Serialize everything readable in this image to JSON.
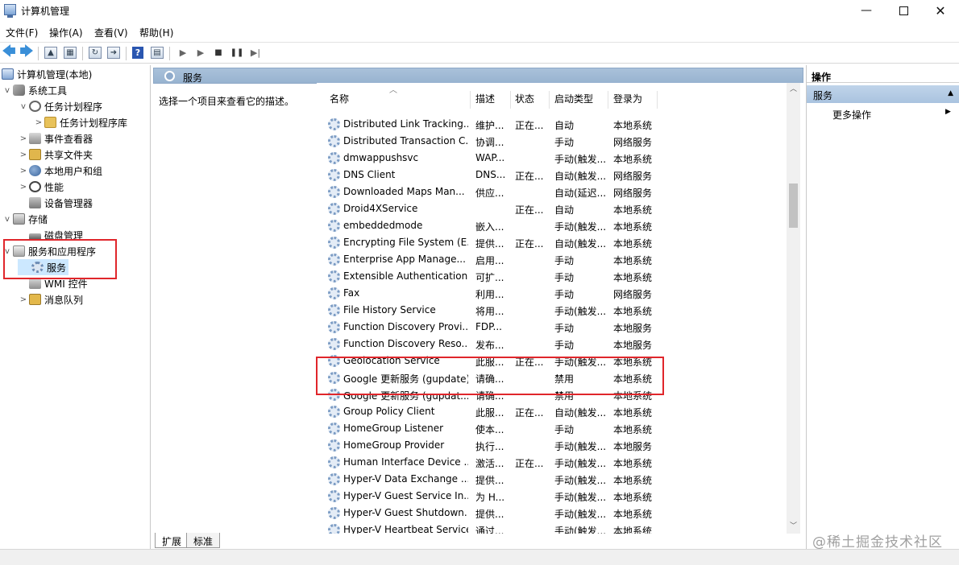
{
  "window": {
    "title": "计算机管理",
    "minimize": "—",
    "close": "✕"
  },
  "menu": [
    "文件(F)",
    "操作(A)",
    "查看(V)",
    "帮助(H)"
  ],
  "toolbar": {
    "back": "🡄",
    "forward": "🡆",
    "help": "?"
  },
  "tree": [
    {
      "label": "计算机管理(本地)",
      "icon": "computer-icon",
      "level": 0,
      "chev": ""
    },
    {
      "label": "系统工具",
      "icon": "tools-icon",
      "level": 1,
      "chev": "v"
    },
    {
      "label": "任务计划程序",
      "icon": "clock-icon",
      "level": 2,
      "chev": "v"
    },
    {
      "label": "任务计划程序库",
      "icon": "folder-icon",
      "level": 3,
      "chev": ">"
    },
    {
      "label": "事件查看器",
      "icon": "event-viewer-icon",
      "level": 2,
      "chev": ">"
    },
    {
      "label": "共享文件夹",
      "icon": "shared-folder-icon",
      "level": 2,
      "chev": ">"
    },
    {
      "label": "本地用户和组",
      "icon": "users-icon",
      "level": 2,
      "chev": ">"
    },
    {
      "label": "性能",
      "icon": "performance-icon",
      "level": 2,
      "chev": ">"
    },
    {
      "label": "设备管理器",
      "icon": "device-manager-icon",
      "level": 2,
      "chev": ""
    },
    {
      "label": "存储",
      "icon": "storage-icon",
      "level": 1,
      "chev": "v"
    },
    {
      "label": "磁盘管理",
      "icon": "disk-icon",
      "level": 2,
      "chev": ""
    },
    {
      "label": "服务和应用程序",
      "icon": "services-apps-icon",
      "level": 1,
      "chev": "v"
    },
    {
      "label": "服务",
      "icon": "gear-icon",
      "level": 2,
      "chev": "",
      "selected": true
    },
    {
      "label": "WMI 控件",
      "icon": "wmi-icon",
      "level": 2,
      "chev": ""
    },
    {
      "label": "消息队列",
      "icon": "message-queue-icon",
      "level": 2,
      "chev": ">"
    }
  ],
  "center": {
    "header": "服务",
    "description": "选择一个项目来查看它的描述。",
    "columns": [
      "名称",
      "描述",
      "状态",
      "启动类型",
      "登录为"
    ],
    "rows": [
      [
        "Distributed Link Tracking...",
        "维护...",
        "正在...",
        "自动",
        "本地系统"
      ],
      [
        "Distributed Transaction C...",
        "协调...",
        "",
        "手动",
        "网络服务"
      ],
      [
        "dmwappushsvc",
        "WAP...",
        "",
        "手动(触发...",
        "本地系统"
      ],
      [
        "DNS Client",
        "DNS...",
        "正在...",
        "自动(触发...",
        "网络服务"
      ],
      [
        "Downloaded Maps Man...",
        "供应...",
        "",
        "自动(延迟...",
        "网络服务"
      ],
      [
        "Droid4XService",
        "",
        "正在...",
        "自动",
        "本地系统"
      ],
      [
        "embeddedmode",
        "嵌入...",
        "",
        "手动(触发...",
        "本地系统"
      ],
      [
        "Encrypting File System (E...",
        "提供...",
        "正在...",
        "自动(触发...",
        "本地系统"
      ],
      [
        "Enterprise App Manage...",
        "启用...",
        "",
        "手动",
        "本地系统"
      ],
      [
        "Extensible Authentication...",
        "可扩...",
        "",
        "手动",
        "本地系统"
      ],
      [
        "Fax",
        "利用...",
        "",
        "手动",
        "网络服务"
      ],
      [
        "File History Service",
        "将用...",
        "",
        "手动(触发...",
        "本地系统"
      ],
      [
        "Function Discovery Provi...",
        "FDP...",
        "",
        "手动",
        "本地服务"
      ],
      [
        "Function Discovery Reso...",
        "发布...",
        "",
        "手动",
        "本地服务"
      ],
      [
        "Geolocation Service",
        "此服...",
        "正在...",
        "手动(触发...",
        "本地系统"
      ],
      [
        "Google 更新服务 (gupdate)",
        "请确...",
        "",
        "禁用",
        "本地系统"
      ],
      [
        "Google 更新服务 (gupdat...",
        "请确...",
        "",
        "禁用",
        "本地系统"
      ],
      [
        "Group Policy Client",
        "此服...",
        "正在...",
        "自动(触发...",
        "本地系统"
      ],
      [
        "HomeGroup Listener",
        "使本...",
        "",
        "手动",
        "本地系统"
      ],
      [
        "HomeGroup Provider",
        "执行...",
        "",
        "手动(触发...",
        "本地服务"
      ],
      [
        "Human Interface Device ...",
        "激活...",
        "正在...",
        "手动(触发...",
        "本地系统"
      ],
      [
        "Hyper-V Data Exchange ...",
        "提供...",
        "",
        "手动(触发...",
        "本地系统"
      ],
      [
        "Hyper-V Guest Service In...",
        "为 H...",
        "",
        "手动(触发...",
        "本地系统"
      ],
      [
        "Hyper-V Guest Shutdown...",
        "提供...",
        "",
        "手动(触发...",
        "本地系统"
      ],
      [
        "Hyper-V Heartbeat Service",
        "通过...",
        "",
        "手动(触发...",
        "本地系统"
      ]
    ],
    "tabs": [
      "扩展",
      "标准"
    ]
  },
  "actions": {
    "title": "操作",
    "section": "服务",
    "more": "更多操作"
  },
  "watermark": "@稀土掘金技术社区"
}
